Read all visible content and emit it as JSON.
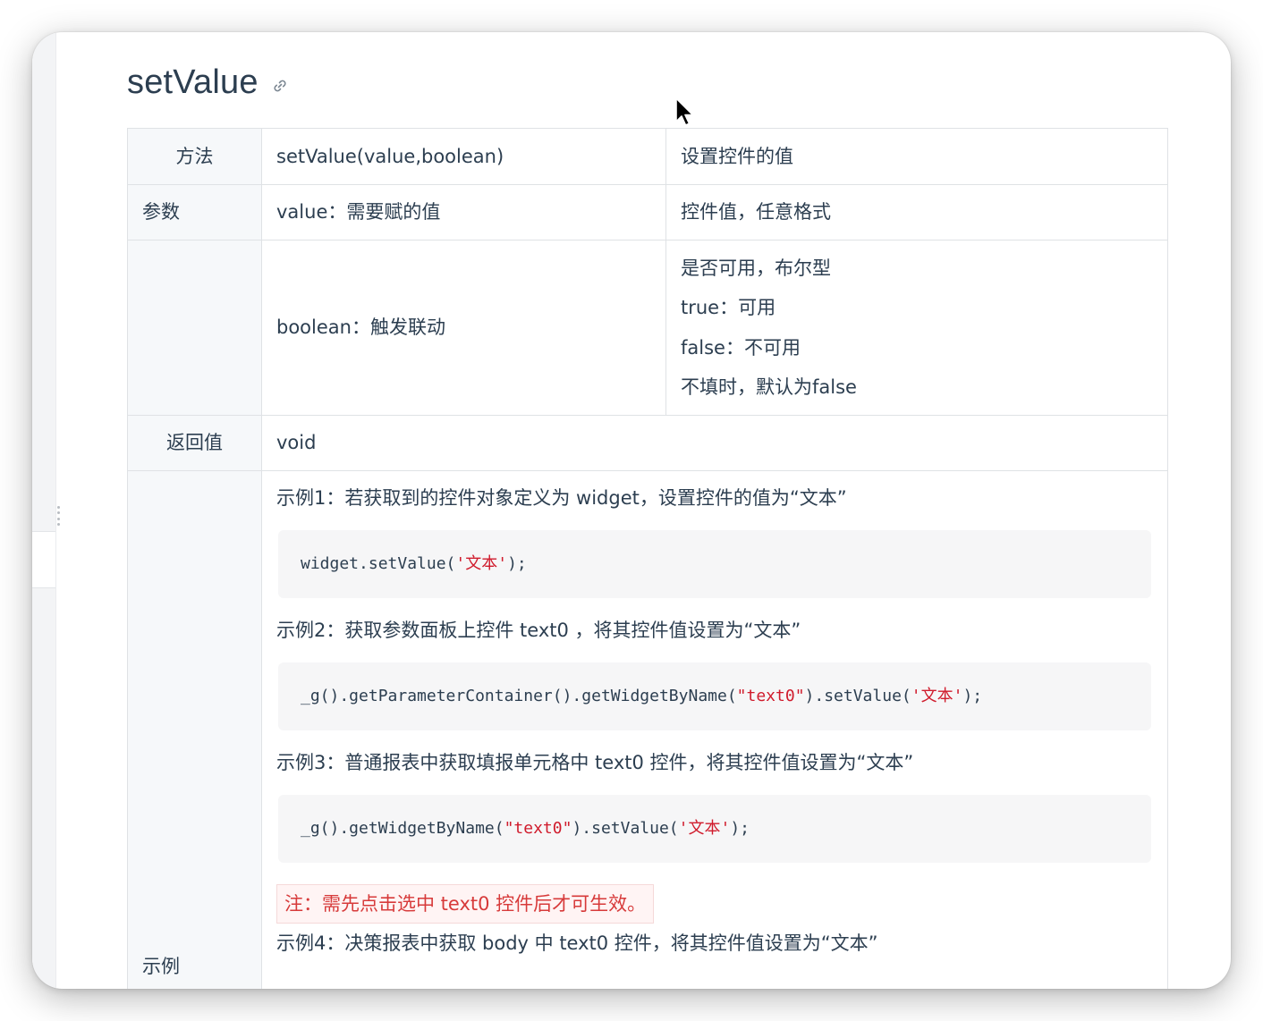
{
  "page": {
    "title": "setValue",
    "link_icon": "link-icon"
  },
  "table": {
    "method": {
      "label": "方法",
      "signature": "setValue(value,boolean)",
      "description": "设置控件的值"
    },
    "params": {
      "label": "参数",
      "rows": [
        {
          "name": "value：需要赋的值",
          "description_lines": [
            "控件值，任意格式"
          ]
        },
        {
          "name": "boolean：触发联动",
          "description_lines": [
            "是否可用，布尔型",
            "true：可用",
            "false：不可用",
            "不填时，默认为false"
          ]
        }
      ]
    },
    "return": {
      "label": "返回值",
      "value": "void"
    },
    "examples": {
      "label": "示例",
      "items": [
        {
          "text": "示例1：若获取到的控件对象定义为 widget，设置控件的值为“文本”"
        },
        {
          "text": "示例2：获取参数面板上控件 text0 ，将其控件值设置为“文本”"
        },
        {
          "text": "示例3：普通报表中获取填报单元格中 text0 控件，将其控件值设置为“文本”"
        },
        {
          "text": "示例4：决策报表中获取 body 中 text0 控件，将其控件值设置为“文本”"
        }
      ],
      "code": [
        {
          "pre": "widget.setValue(",
          "str": "'文本'",
          "post": ");"
        },
        {
          "pre": "_g().getParameterContainer().getWidgetByName(",
          "str": "\"text0\"",
          "mid": ").setValue(",
          "str2": "'文本'",
          "post": ");"
        },
        {
          "pre": "_g().getWidgetByName(",
          "str": "\"text0\"",
          "mid": ").setValue(",
          "str2": "'文本'",
          "post": ");"
        }
      ],
      "note": "注：需先点击选中 text0 控件后才可生效。"
    }
  },
  "colors": {
    "text": "#2c3e50",
    "header_bg": "#f6f8fa",
    "border": "#dfe2e5",
    "code_bg": "#f6f6f7",
    "code_string": "#d01b2c",
    "note_text": "#d73a3a",
    "note_bg": "#fff4f4"
  }
}
